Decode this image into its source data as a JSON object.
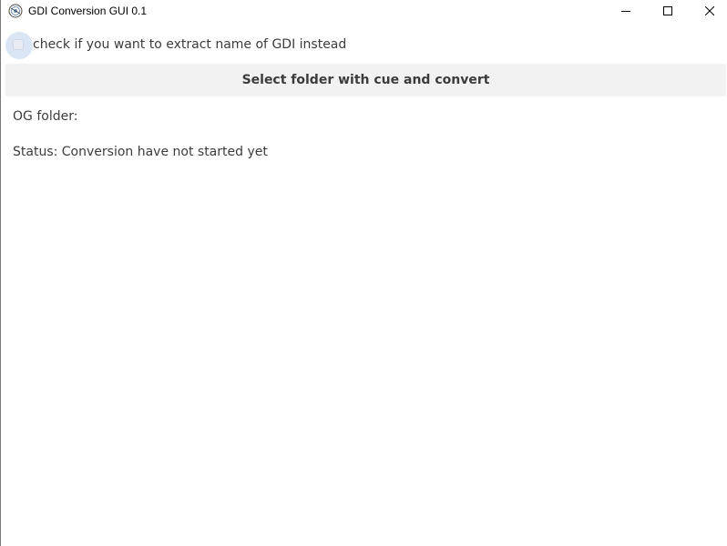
{
  "window": {
    "title": "GDI Conversion GUI 0.1",
    "icon": "app-logo-icon",
    "controls": {
      "minimize": "minimize-icon",
      "maximize": "maximize-icon",
      "close": "close-icon"
    }
  },
  "options": {
    "extract_name_label": "check if you want to extract name of GDI instead",
    "extract_name_checked": false
  },
  "actions": {
    "convert_label": "Select folder with cue and convert"
  },
  "info": {
    "og_folder_label": "OG folder:",
    "status_text": "Status: Conversion have not started yet"
  },
  "colors": {
    "button_bg": "#f2f2f2",
    "text": "#3c3c3c",
    "checkbox_halo": "#dbe6f5"
  }
}
